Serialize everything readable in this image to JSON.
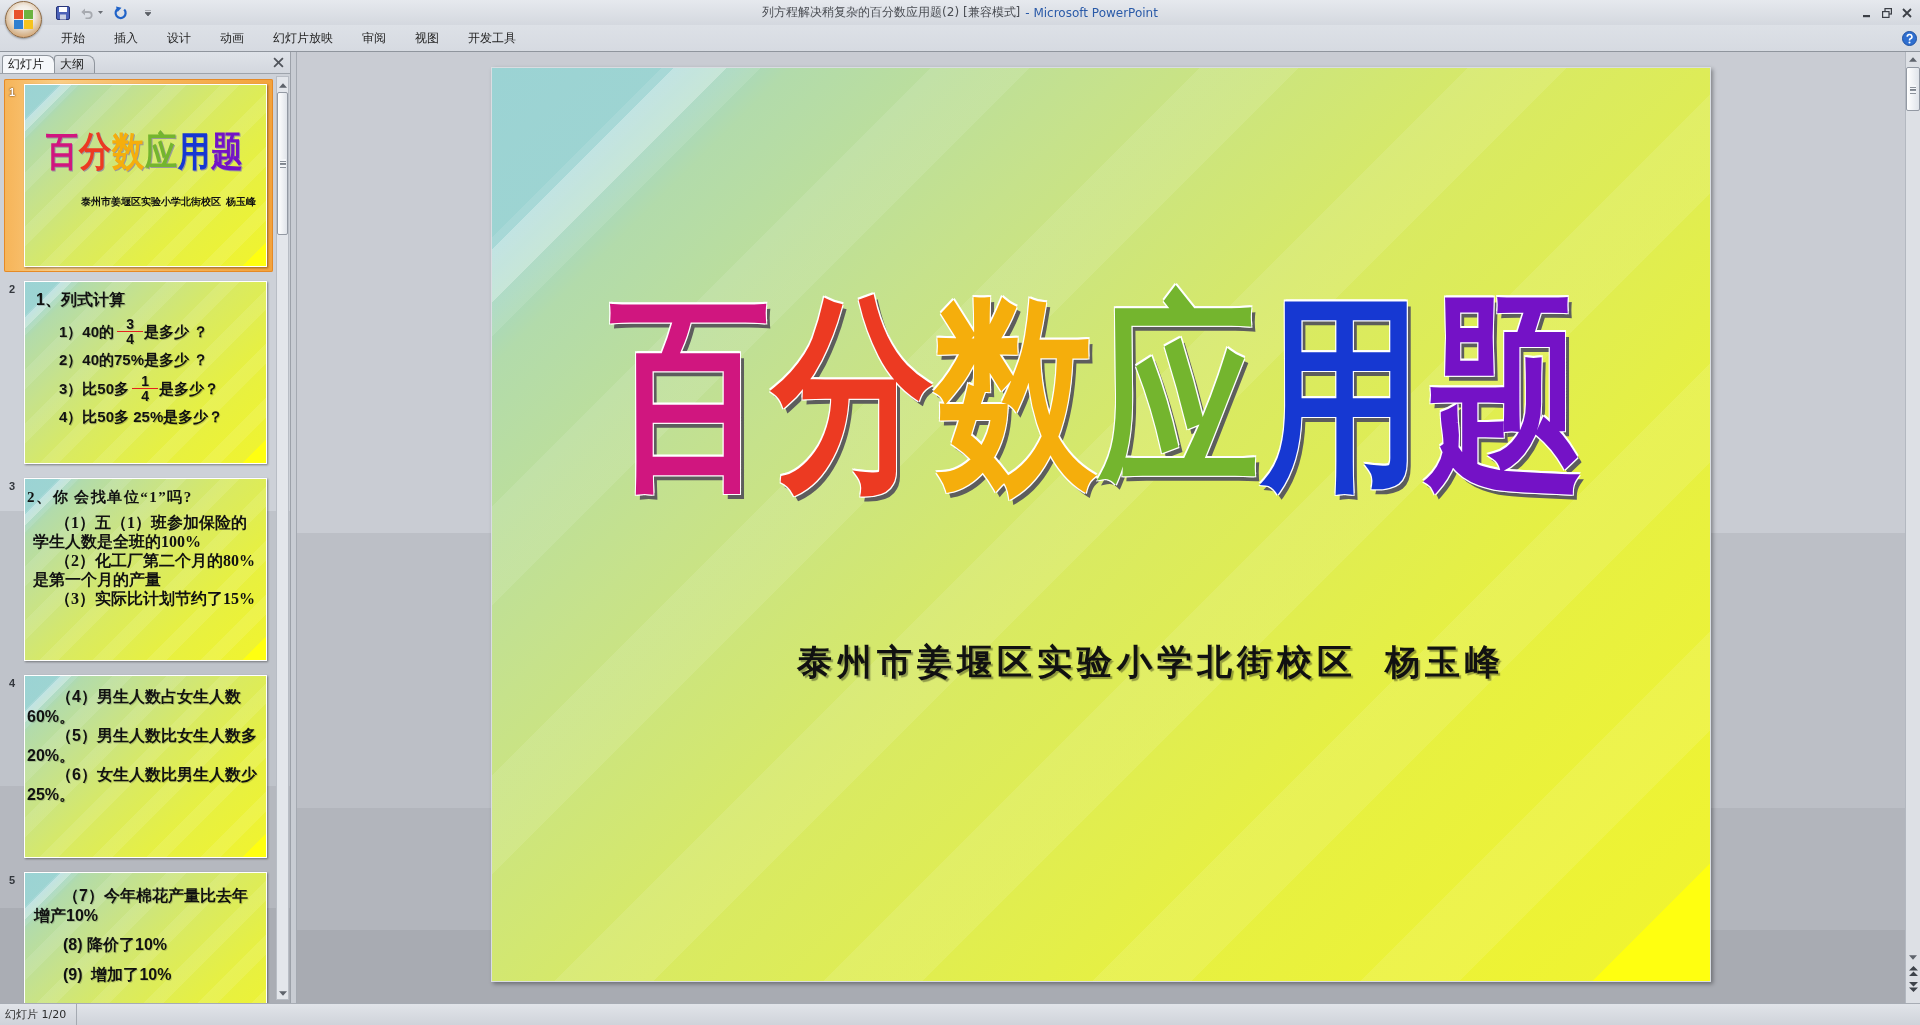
{
  "window": {
    "document_title": "列方程解决稍复杂的百分数应用题(2) [兼容模式]",
    "app_title": "- Microsoft PowerPoint"
  },
  "quick_access": [
    {
      "kind": "save",
      "disabled": false
    },
    {
      "kind": "undo",
      "disabled": true
    },
    {
      "kind": "redo",
      "disabled": false
    }
  ],
  "ribbon_tabs": [
    {
      "label": "开始",
      "selected": false
    },
    {
      "label": "插入",
      "selected": false
    },
    {
      "label": "设计",
      "selected": false
    },
    {
      "label": "动画",
      "selected": false
    },
    {
      "label": "幻灯片放映",
      "selected": false
    },
    {
      "label": "审阅",
      "selected": false
    },
    {
      "label": "视图",
      "selected": false
    },
    {
      "label": "开发工具",
      "selected": false
    }
  ],
  "slides_pane": {
    "tabs": [
      {
        "label": "幻灯片",
        "selected": true
      },
      {
        "label": "大纲",
        "selected": false
      }
    ],
    "thumbnails": [
      {
        "number": "1",
        "selected": true,
        "kind": "title",
        "title": "百分数应用题",
        "subtitle": "泰州市姜堰区实验小学北街校区  杨玉峰"
      },
      {
        "number": "2",
        "selected": false,
        "kind": "exercise",
        "heading": "1、列式计算",
        "lines": [
          {
            "parts": [
              {
                "kind": "text",
                "text": "1）40的"
              },
              {
                "kind": "fraction",
                "numerator": "3",
                "denominator": "4"
              },
              {
                "kind": "text",
                "text": "是多少 ？"
              }
            ]
          },
          {
            "parts": [
              {
                "kind": "text",
                "text": "2）40的75%是多少 ？"
              }
            ]
          },
          {
            "parts": [
              {
                "kind": "text",
                "text": "3）比50多"
              },
              {
                "kind": "fraction",
                "numerator": "1",
                "denominator": "4"
              },
              {
                "kind": "text",
                "text": "是多少？"
              }
            ]
          },
          {
            "parts": [
              {
                "kind": "text",
                "text": "4）比50多 25%是多少？"
              }
            ]
          }
        ]
      },
      {
        "number": "3",
        "selected": false,
        "kind": "questions",
        "heading": "2、你 会找单位“1”吗?",
        "paragraphs": [
          "（1）五（1）班参加保险的学生人数是全班的100%",
          "（2）化工厂第二个月的80%是第一个月的产量",
          "（3）实际比计划节约了15%"
        ]
      },
      {
        "number": "4",
        "selected": false,
        "kind": "statements",
        "paragraphs": [
          "（4）男生人数占女生人数60%。",
          "（5）男生人数比女生人数多20%。",
          "（6）女生人数比男生人数少25%。"
        ]
      },
      {
        "number": "5",
        "selected": false,
        "kind": "spaced_statements",
        "paragraphs": [
          "（7）今年棉花产量比去年增产10%",
          "(8) 降价了10%",
          "(9)  增加了10%"
        ]
      }
    ]
  },
  "slide": {
    "title": "百分数应用题",
    "subtitle": "泰州市姜堰区实验小学北街校区  杨玉峰"
  },
  "status_bar": {
    "slide_counter": "幻灯片 1/20"
  }
}
